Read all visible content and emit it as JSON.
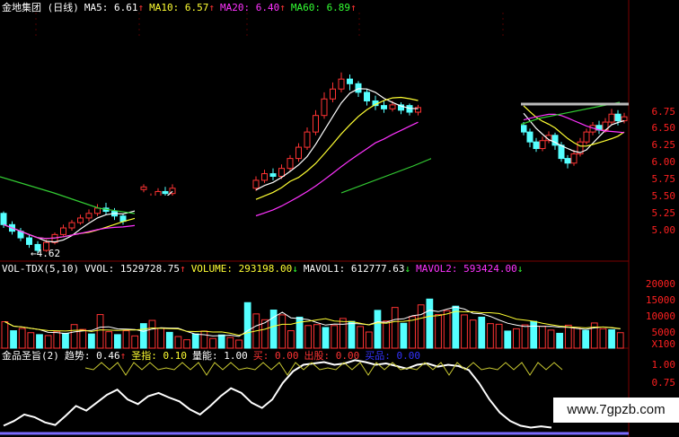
{
  "main_header": {
    "title": "金地集团 (日线)",
    "items": [
      {
        "label": "MA5:",
        "value": "6.61",
        "arrow": "↑",
        "color": "#ffffff"
      },
      {
        "label": "MA10:",
        "value": "6.57",
        "arrow": "↑",
        "color": "#ffff33"
      },
      {
        "label": "MA20:",
        "value": "6.40",
        "arrow": "↑",
        "color": "#ff33ff"
      },
      {
        "label": "MA60:",
        "value": "6.89",
        "arrow": "↑",
        "color": "#33ff33"
      }
    ]
  },
  "vol_header": {
    "title": "VOL-TDX(5,10)",
    "items": [
      {
        "label": "VVOL:",
        "value": "1529728.75",
        "arrow": "↑",
        "color": "#ffffff"
      },
      {
        "label": "VOLUME:",
        "value": "293198.00",
        "arrow": "↓",
        "color": "#ffff33"
      },
      {
        "label": "MAVOL1:",
        "value": "612777.63",
        "arrow": "↓",
        "color": "#ffffff"
      },
      {
        "label": "MAVOL2:",
        "value": "593424.00",
        "arrow": "↓",
        "color": "#ff33ff"
      }
    ]
  },
  "ind_header": {
    "title": "金品圣旨(2)",
    "items": [
      {
        "label": "趋势:",
        "value": "0.46",
        "arrow": "↑",
        "color": "#ffffff"
      },
      {
        "label": "圣指:",
        "value": "0.10",
        "arrow": "",
        "color": "#ffff33"
      },
      {
        "label": "量能:",
        "value": "1.00",
        "arrow": "",
        "color": "#ffffff"
      },
      {
        "label": "买:",
        "value": "0.00",
        "arrow": "",
        "color": "#ff3333"
      },
      {
        "label": "出股:",
        "value": "0.00",
        "arrow": "",
        "color": "#ff3333"
      },
      {
        "label": "买品:",
        "value": "0.00",
        "arrow": "",
        "color": "#3333ff"
      }
    ]
  },
  "price_axis": [
    "6.75",
    "6.50",
    "6.25",
    "6.00",
    "5.75",
    "5.50",
    "5.25",
    "5.00"
  ],
  "vol_axis": [
    "20000",
    "15000",
    "10000",
    "5000",
    "X100"
  ],
  "ind_axis": [
    "1.00",
    "0.75"
  ],
  "low_label": "←4.62",
  "watermark": "www.7gpzb.com",
  "chart_data": [
    {
      "type": "candlestick",
      "title": "金地集团 (日线)",
      "ylim": [
        4.5,
        7.0
      ],
      "yticks": [
        5.0,
        5.25,
        5.5,
        5.75,
        6.0,
        6.25,
        6.5,
        6.75
      ],
      "low_marker": 4.62,
      "candles": [
        [
          5.22,
          5.05,
          5.25,
          5.0
        ],
        [
          5.05,
          4.95,
          5.1,
          4.9
        ],
        [
          4.95,
          4.85,
          5.0,
          4.8
        ],
        [
          4.85,
          4.75,
          4.9,
          4.7
        ],
        [
          4.75,
          4.66,
          4.8,
          4.62
        ],
        [
          4.66,
          4.78,
          4.82,
          4.64
        ],
        [
          4.78,
          4.9,
          4.93,
          4.75
        ],
        [
          4.9,
          5.0,
          5.05,
          4.88
        ],
        [
          5.0,
          5.08,
          5.12,
          4.96
        ],
        [
          5.08,
          5.15,
          5.2,
          5.05
        ],
        [
          5.15,
          5.22,
          5.28,
          5.1
        ],
        [
          5.22,
          5.3,
          5.36,
          5.18
        ],
        [
          5.3,
          5.25,
          5.38,
          5.2
        ],
        [
          5.25,
          5.18,
          5.3,
          5.12
        ],
        [
          5.18,
          5.1,
          5.22,
          5.05
        ],
        [
          5.58,
          5.62,
          5.66,
          5.54
        ],
        [
          5.4,
          5.48,
          5.52,
          5.36
        ],
        [
          5.48,
          5.55,
          5.6,
          5.44
        ],
        [
          5.55,
          5.52,
          5.62,
          5.46
        ],
        [
          5.52,
          5.6,
          5.66,
          5.48
        ],
        [
          5.6,
          5.72,
          5.78,
          5.56
        ],
        [
          5.72,
          5.82,
          5.88,
          5.68
        ],
        [
          5.82,
          5.78,
          5.9,
          5.72
        ],
        [
          5.78,
          5.9,
          5.96,
          5.74
        ],
        [
          5.9,
          6.05,
          6.1,
          5.86
        ],
        [
          6.05,
          6.22,
          6.28,
          6.0
        ],
        [
          6.22,
          6.45,
          6.52,
          6.18
        ],
        [
          6.45,
          6.7,
          6.78,
          6.4
        ],
        [
          6.7,
          6.95,
          7.05,
          6.65
        ],
        [
          6.95,
          7.1,
          7.2,
          6.9
        ],
        [
          7.1,
          7.25,
          7.35,
          7.05
        ],
        [
          7.25,
          7.18,
          7.32,
          7.08
        ],
        [
          7.18,
          7.05,
          7.22,
          6.98
        ],
        [
          7.05,
          6.92,
          7.1,
          6.85
        ],
        [
          6.92,
          6.85,
          7.0,
          6.78
        ],
        [
          6.85,
          6.8,
          6.92,
          6.74
        ],
        [
          6.8,
          6.86,
          6.92,
          6.76
        ],
        [
          6.86,
          6.78,
          6.9,
          6.72
        ],
        [
          6.85,
          6.75,
          6.88,
          6.7
        ],
        [
          6.75,
          6.82,
          6.86,
          6.7
        ],
        [
          6.55,
          6.45,
          6.6,
          6.4
        ],
        [
          6.45,
          6.3,
          6.5,
          6.22
        ],
        [
          6.3,
          6.2,
          6.36,
          6.15
        ],
        [
          6.2,
          6.32,
          6.38,
          6.16
        ],
        [
          6.32,
          6.4,
          6.46,
          6.28
        ],
        [
          6.4,
          6.25,
          6.44,
          6.18
        ],
        [
          6.25,
          6.05,
          6.3,
          6.0
        ],
        [
          6.05,
          5.98,
          6.1,
          5.9
        ],
        [
          5.98,
          6.12,
          6.18,
          5.94
        ],
        [
          6.12,
          6.3,
          6.36,
          6.08
        ],
        [
          6.3,
          6.45,
          6.5,
          6.26
        ],
        [
          6.45,
          6.55,
          6.6,
          6.4
        ],
        [
          6.55,
          6.48,
          6.62,
          6.42
        ],
        [
          6.48,
          6.6,
          6.66,
          6.44
        ],
        [
          6.6,
          6.72,
          6.8,
          6.56
        ],
        [
          6.72,
          6.62,
          6.78,
          6.55
        ],
        [
          6.62,
          6.68,
          6.74,
          6.58
        ]
      ]
    },
    {
      "type": "bar",
      "title": "VOL-TDX(5,10)",
      "ylim": [
        0,
        22000
      ],
      "yticks": [
        5000,
        10000,
        15000,
        20000
      ],
      "values": [
        8200,
        5400,
        6100,
        4800,
        4200,
        3900,
        5200,
        4600,
        7300,
        5800,
        4400,
        10400,
        5100,
        4200,
        5400,
        3800,
        7600,
        8600,
        6200,
        4900,
        3600,
        2600,
        4400,
        5300,
        3000,
        4100,
        3300,
        2500,
        14100,
        10600,
        8800,
        11800,
        10300,
        5400,
        9600,
        7000,
        7300,
        6400,
        7000,
        9200,
        8300,
        6700,
        5000,
        11700,
        8400,
        12600,
        7700,
        9800,
        13400,
        15200,
        10400,
        11600,
        13000,
        10300,
        8700,
        9600,
        7600,
        7400,
        5300,
        6000,
        7200,
        8300,
        6800,
        5600,
        4600,
        7100,
        6400,
        5500,
        7800,
        6000,
        5700,
        4800
      ]
    },
    {
      "type": "line",
      "title": "金品圣旨(2)",
      "ylim": [
        0,
        1.2
      ],
      "yticks": [
        0.75,
        1.0
      ],
      "values": [
        0.05,
        0.12,
        0.22,
        0.18,
        0.1,
        0.06,
        0.2,
        0.35,
        0.28,
        0.4,
        0.52,
        0.6,
        0.45,
        0.38,
        0.5,
        0.55,
        0.48,
        0.42,
        0.3,
        0.22,
        0.35,
        0.5,
        0.62,
        0.55,
        0.4,
        0.32,
        0.45,
        0.7,
        0.88,
        0.98,
        1.0,
        1.02,
        0.98,
        1.0,
        1.05,
        1.02,
        0.98,
        1.0,
        0.96,
        0.92,
        0.98,
        1.0,
        0.95,
        0.98,
        0.96,
        0.9,
        0.7,
        0.45,
        0.25,
        0.12,
        0.05,
        0.02,
        0.04,
        0.02
      ]
    }
  ]
}
